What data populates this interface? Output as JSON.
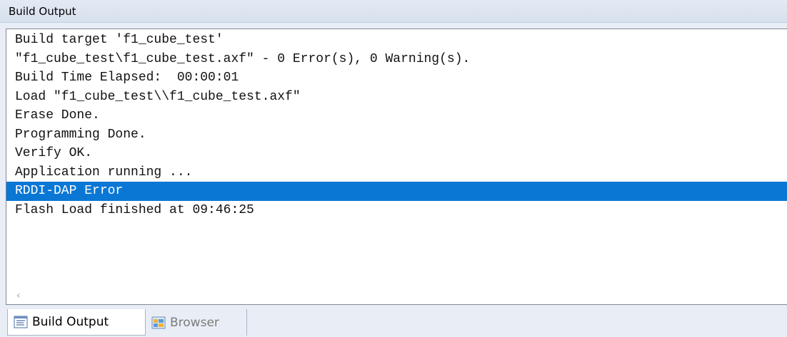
{
  "window": {
    "title": "Build Output"
  },
  "log": {
    "lines": [
      "Build target 'f1_cube_test'",
      "\"f1_cube_test\\f1_cube_test.axf\" - 0 Error(s), 0 Warning(s).",
      "Build Time Elapsed:  00:00:01",
      "Load \"f1_cube_test\\\\f1_cube_test.axf\"",
      "Erase Done.",
      "Programming Done.",
      "Verify OK.",
      "Application running ...",
      "RDDI-DAP Error",
      "Flash Load finished at 09:46:25"
    ],
    "selected_index": 8
  },
  "tabs": [
    {
      "label": "Build Output",
      "icon": "build-output-icon",
      "active": true
    },
    {
      "label": "Browser",
      "icon": "browser-icon",
      "active": false
    }
  ],
  "colors": {
    "selection": "#0a77d5",
    "selection_text": "#ffffff",
    "chrome": "#e9eef6"
  }
}
